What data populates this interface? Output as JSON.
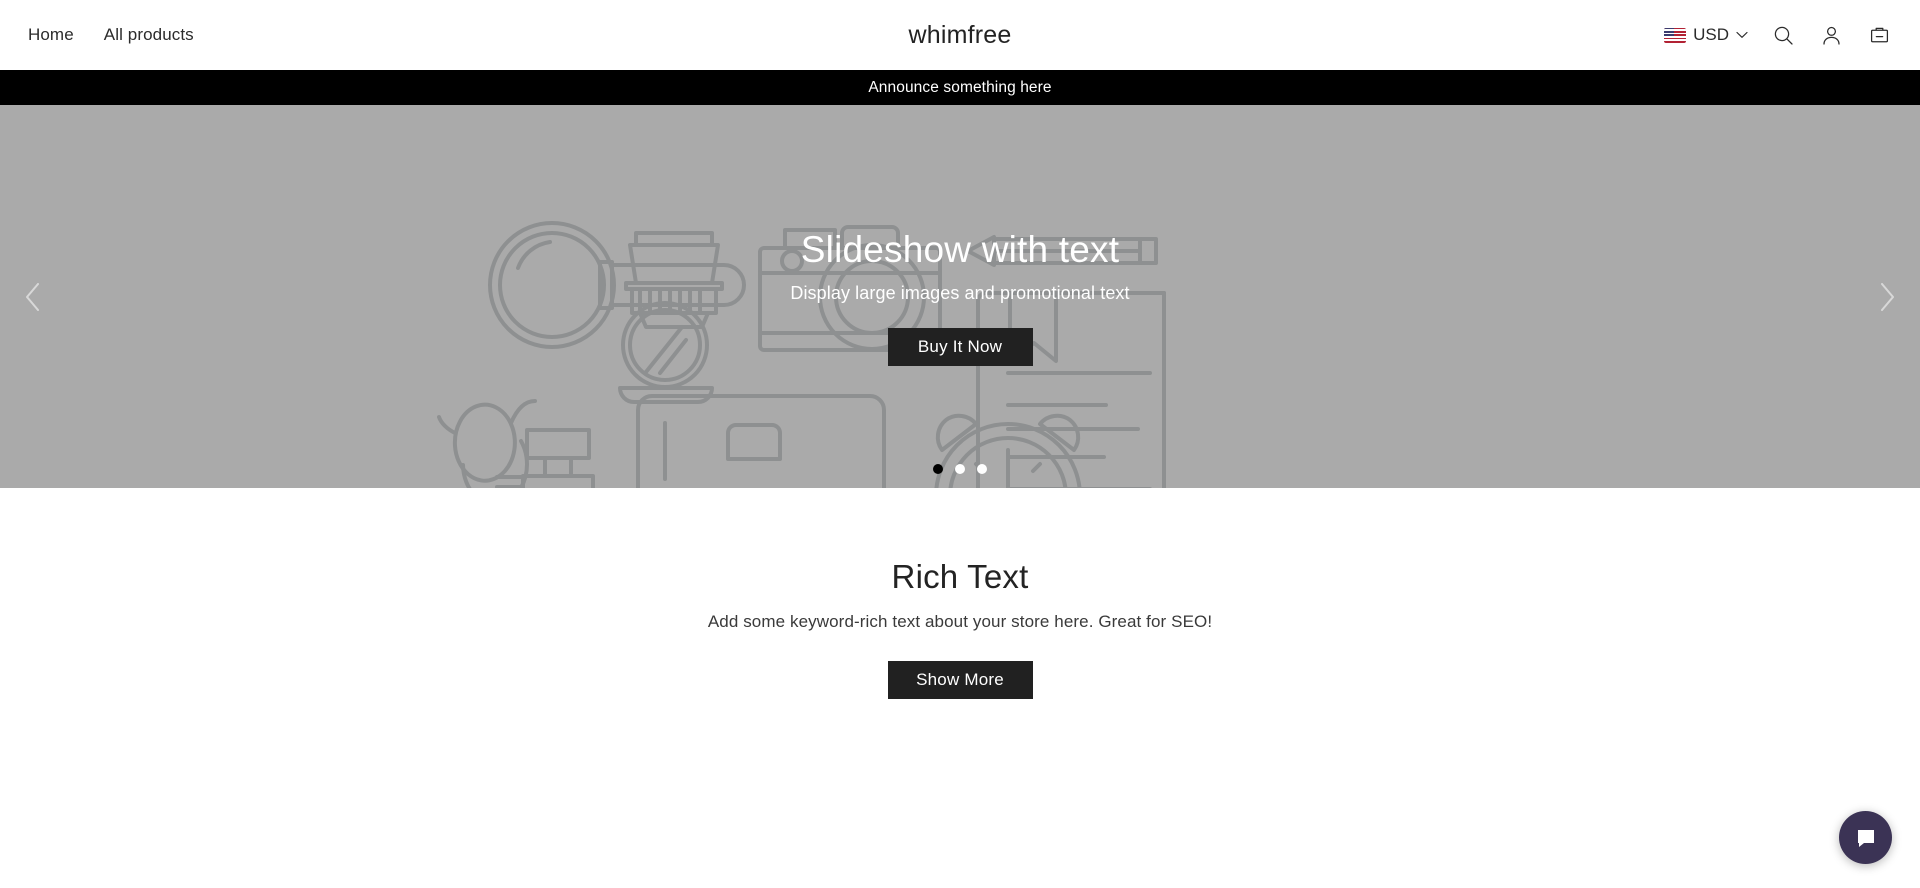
{
  "header": {
    "nav": [
      {
        "label": "Home",
        "name": "nav-link-home"
      },
      {
        "label": "All products",
        "name": "nav-link-all-products"
      }
    ],
    "brand": "whimfree",
    "currency": {
      "code": "USD",
      "flag": "us-flag-icon",
      "chevron": "chevron-down-icon"
    },
    "icons": {
      "search": "search-icon",
      "account": "account-icon",
      "cart": "shopping-bag-icon"
    }
  },
  "announcement": {
    "text": "Announce something here"
  },
  "hero": {
    "title": "Slideshow with text",
    "subtitle": "Display large images and promotional text",
    "cta": "Buy It Now",
    "prev_icon": "chevron-left-icon",
    "next_icon": "chevron-right-icon",
    "slides": 3,
    "active_slide": 1,
    "background_color": "#aaaaaa",
    "line_art_color": "#8e9091"
  },
  "richtext": {
    "title": "Rich Text",
    "subtitle": "Add some keyword-rich text about your store here. Great for SEO!",
    "cta": "Show More"
  },
  "chat": {
    "icon": "chat-bubble-icon",
    "color": "#3b3355"
  }
}
